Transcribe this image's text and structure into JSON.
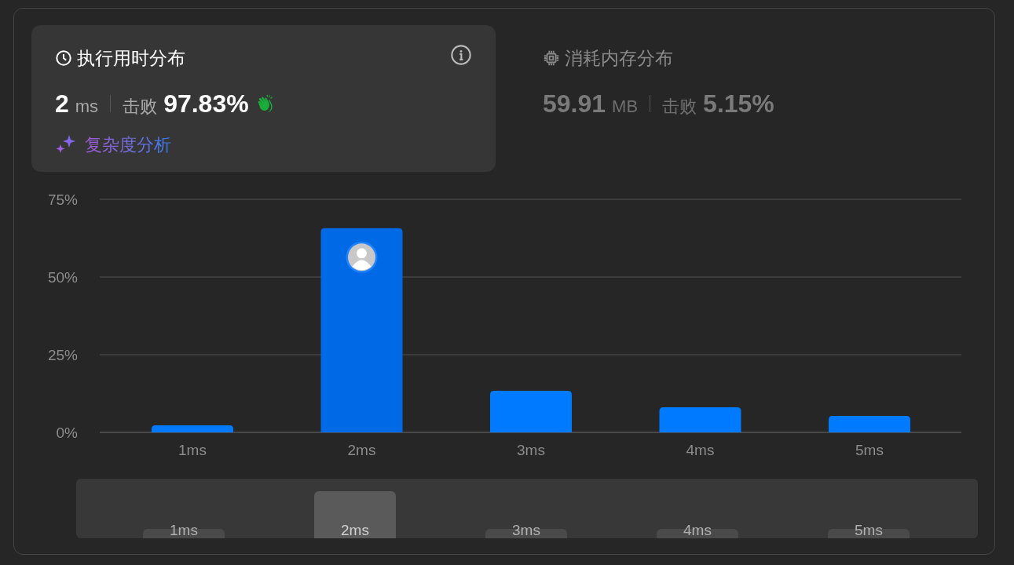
{
  "tabs": [
    {
      "kind": "runtime",
      "title": "执行用时分布",
      "value": "2",
      "unit": "ms",
      "beats_label": "击败",
      "beats": "97.83%",
      "selected": true,
      "link": "复杂度分析"
    },
    {
      "kind": "memory",
      "title": "消耗内存分布",
      "value": "59.91",
      "unit": "MB",
      "beats_label": "击败",
      "beats": "5.15%",
      "selected": false
    }
  ],
  "chart_data": {
    "type": "bar",
    "categories": [
      "1ms",
      "2ms",
      "3ms",
      "4ms",
      "5ms"
    ],
    "values": [
      2.3,
      65.7,
      13.4,
      8.1,
      5.3
    ],
    "ylim": [
      0,
      75
    ],
    "yticks": [
      {
        "value": 0,
        "label": "0%"
      },
      {
        "value": 25,
        "label": "25%"
      },
      {
        "value": 50,
        "label": "50%"
      },
      {
        "value": 75,
        "label": "75%"
      }
    ]
  },
  "navigator": [
    {
      "label": "1ms",
      "selected": false
    },
    {
      "label": "2ms",
      "selected": true
    },
    {
      "label": "3ms",
      "selected": false
    },
    {
      "label": "4ms",
      "selected": false
    },
    {
      "label": "5ms",
      "selected": false
    }
  ]
}
